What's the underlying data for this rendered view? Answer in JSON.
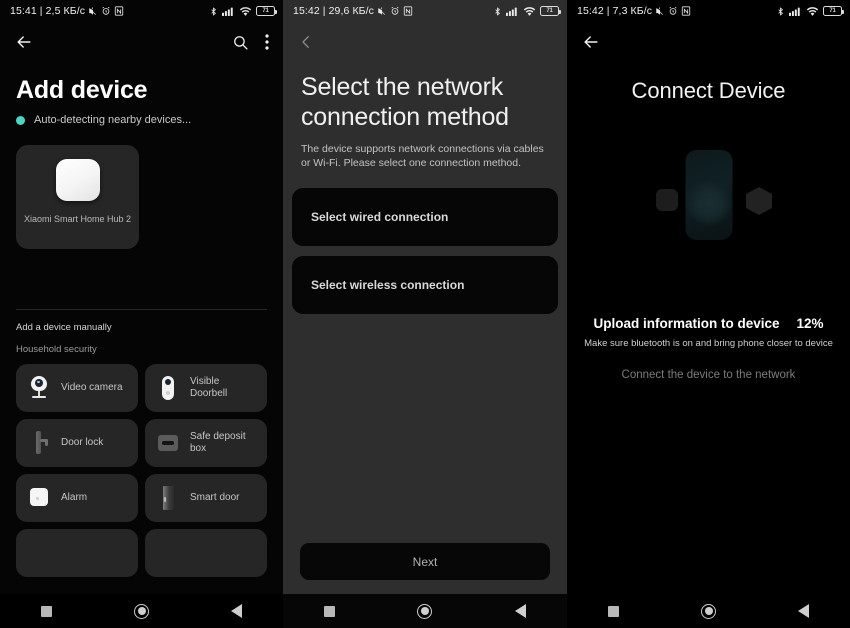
{
  "panels": [
    {
      "status_bar": {
        "time": "15:41",
        "separator": "|",
        "data_rate": "2,5 КБ/c",
        "icons": [
          "mute-icon",
          "alarm-icon",
          "nfc-icon"
        ],
        "right_icons": [
          "bluetooth-icon",
          "cellular-signal-icon",
          "wifi-icon"
        ],
        "battery_level": "71"
      },
      "appbar": {
        "back": "back-arrow-icon",
        "search": "search-icon",
        "overflow": "overflow-menu-icon"
      },
      "title": "Add device",
      "autodetect_text": "Auto-detecting nearby devices...",
      "accent_color": "#4ad6c0",
      "found_device": {
        "name": "Xiaomi Smart Home Hub 2"
      },
      "manual_label": "Add a device manually",
      "category_label": "Household security",
      "devices": [
        {
          "label": "Video camera",
          "icon": "video-camera-icon"
        },
        {
          "label": "Visible Doorbell",
          "icon": "doorbell-icon"
        },
        {
          "label": "Door lock",
          "icon": "door-lock-icon"
        },
        {
          "label": "Safe deposit box",
          "icon": "safe-box-icon"
        },
        {
          "label": "Alarm",
          "icon": "alarm-panel-icon"
        },
        {
          "label": "Smart door",
          "icon": "smart-door-icon"
        }
      ]
    },
    {
      "status_bar": {
        "time": "15:42",
        "separator": "|",
        "data_rate": "29,6 КБ/c",
        "battery_level": "71"
      },
      "appbar": {
        "back": "back-chevron-icon"
      },
      "title": "Select the network connection method",
      "subtitle": "The device supports network connections via cables or Wi-Fi. Please select one connection method.",
      "options": [
        {
          "label": "Select wired connection"
        },
        {
          "label": "Select wireless connection"
        }
      ],
      "next_label": "Next"
    },
    {
      "status_bar": {
        "time": "15:42",
        "separator": "|",
        "data_rate": "7,3 КБ/c",
        "battery_level": "71"
      },
      "appbar": {
        "back": "back-arrow-icon"
      },
      "title": "Connect Device",
      "progress_heading": "Upload information to device",
      "progress_percent": "12%",
      "progress_value": 12,
      "hint": "Make sure bluetooth is on and bring phone closer to device",
      "status_step": "Connect the device to the network"
    }
  ],
  "navbar": {
    "recents": "recents-square-icon",
    "home": "home-circle-icon",
    "back": "back-triangle-icon"
  }
}
